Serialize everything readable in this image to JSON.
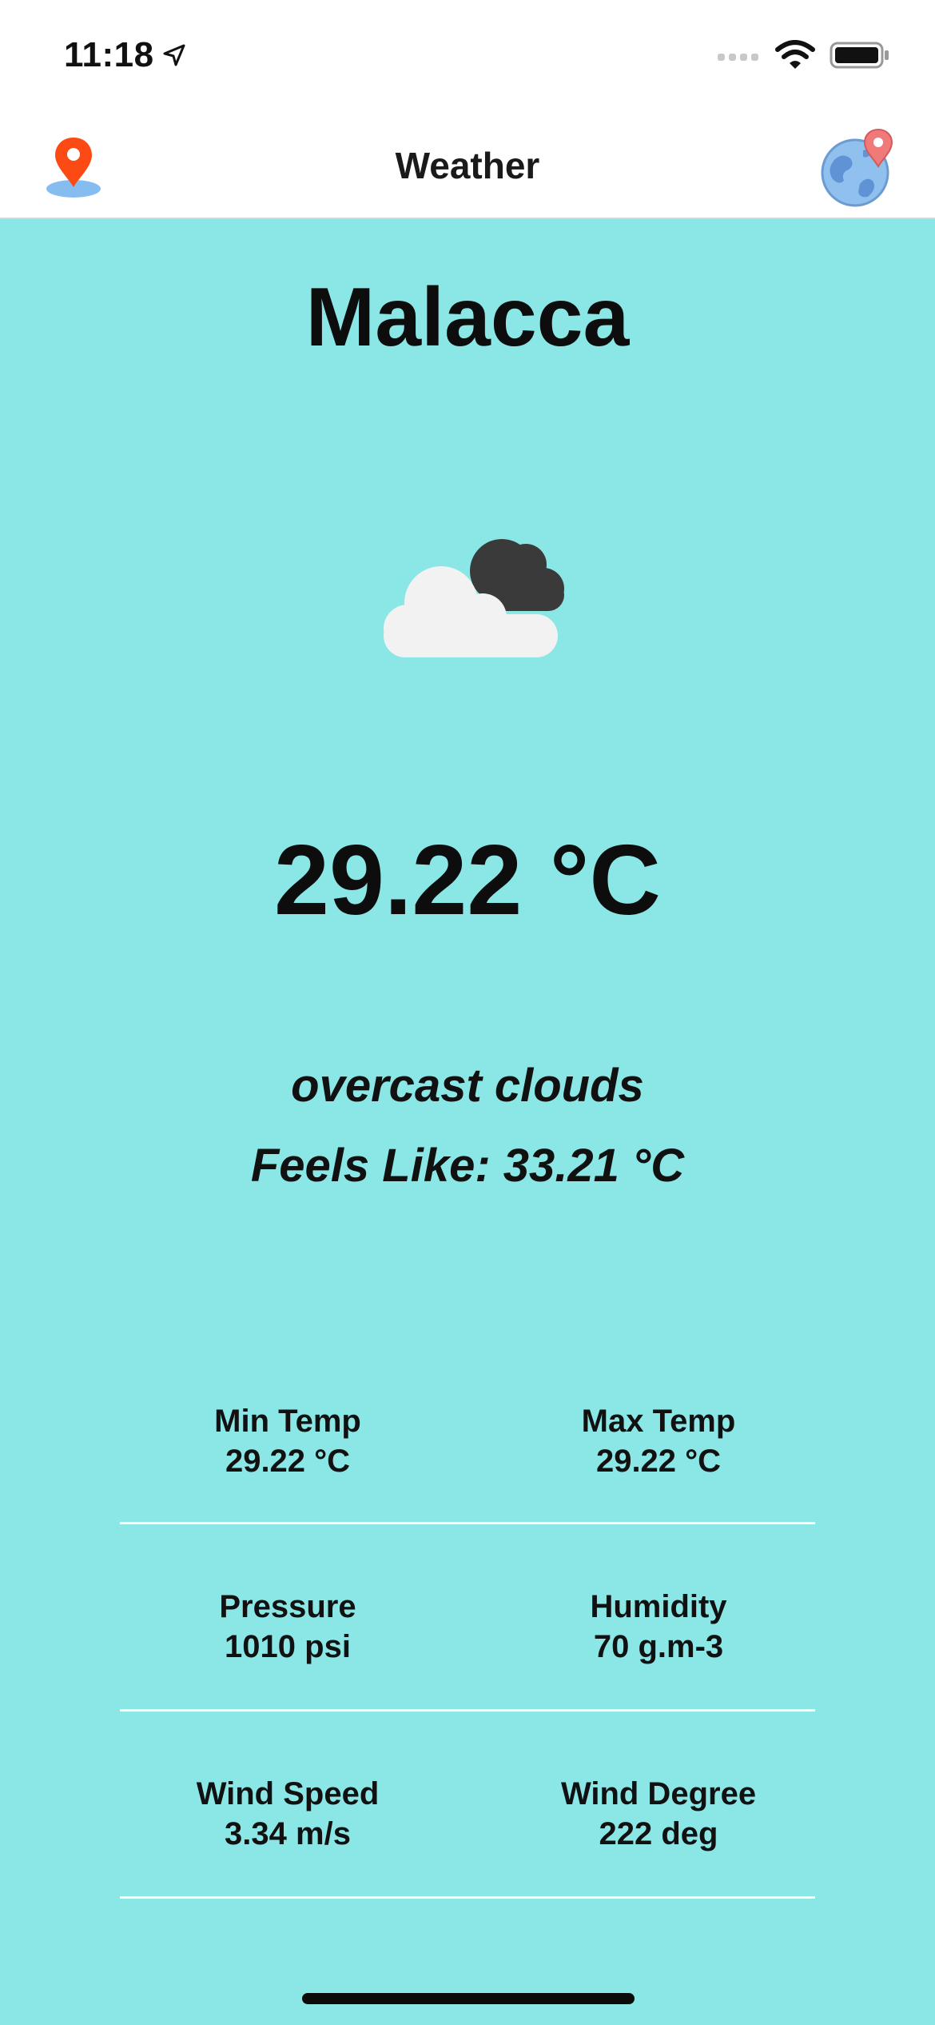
{
  "status_bar": {
    "time": "11:18",
    "icons": [
      "location-arrow-icon",
      "cellular-signal-icon",
      "wifi-icon",
      "battery-icon"
    ]
  },
  "nav": {
    "title": "Weather",
    "left_icon": "map-pin-icon",
    "right_icon": "globe-pin-icon"
  },
  "weather": {
    "city": "Malacca",
    "icon": "overcast-clouds-icon",
    "temperature": "29.22 °C",
    "description": "overcast clouds",
    "feels_like": "Feels Like: 33.21 °C"
  },
  "stats": [
    {
      "left": {
        "label": "Min Temp",
        "value": "29.22 °C"
      },
      "right": {
        "label": "Max Temp",
        "value": "29.22 °C"
      }
    },
    {
      "left": {
        "label": "Pressure",
        "value": "1010 psi"
      },
      "right": {
        "label": "Humidity",
        "value": "70 g.m-3"
      }
    },
    {
      "left": {
        "label": "Wind Speed",
        "value": "3.34 m/s"
      },
      "right": {
        "label": "Wind Degree",
        "value": "222 deg"
      }
    }
  ],
  "colors": {
    "background": "#8ae7e6",
    "pin": "#fb4a14",
    "pin_shadow": "#86bdf0",
    "divider": "#ffffff"
  }
}
